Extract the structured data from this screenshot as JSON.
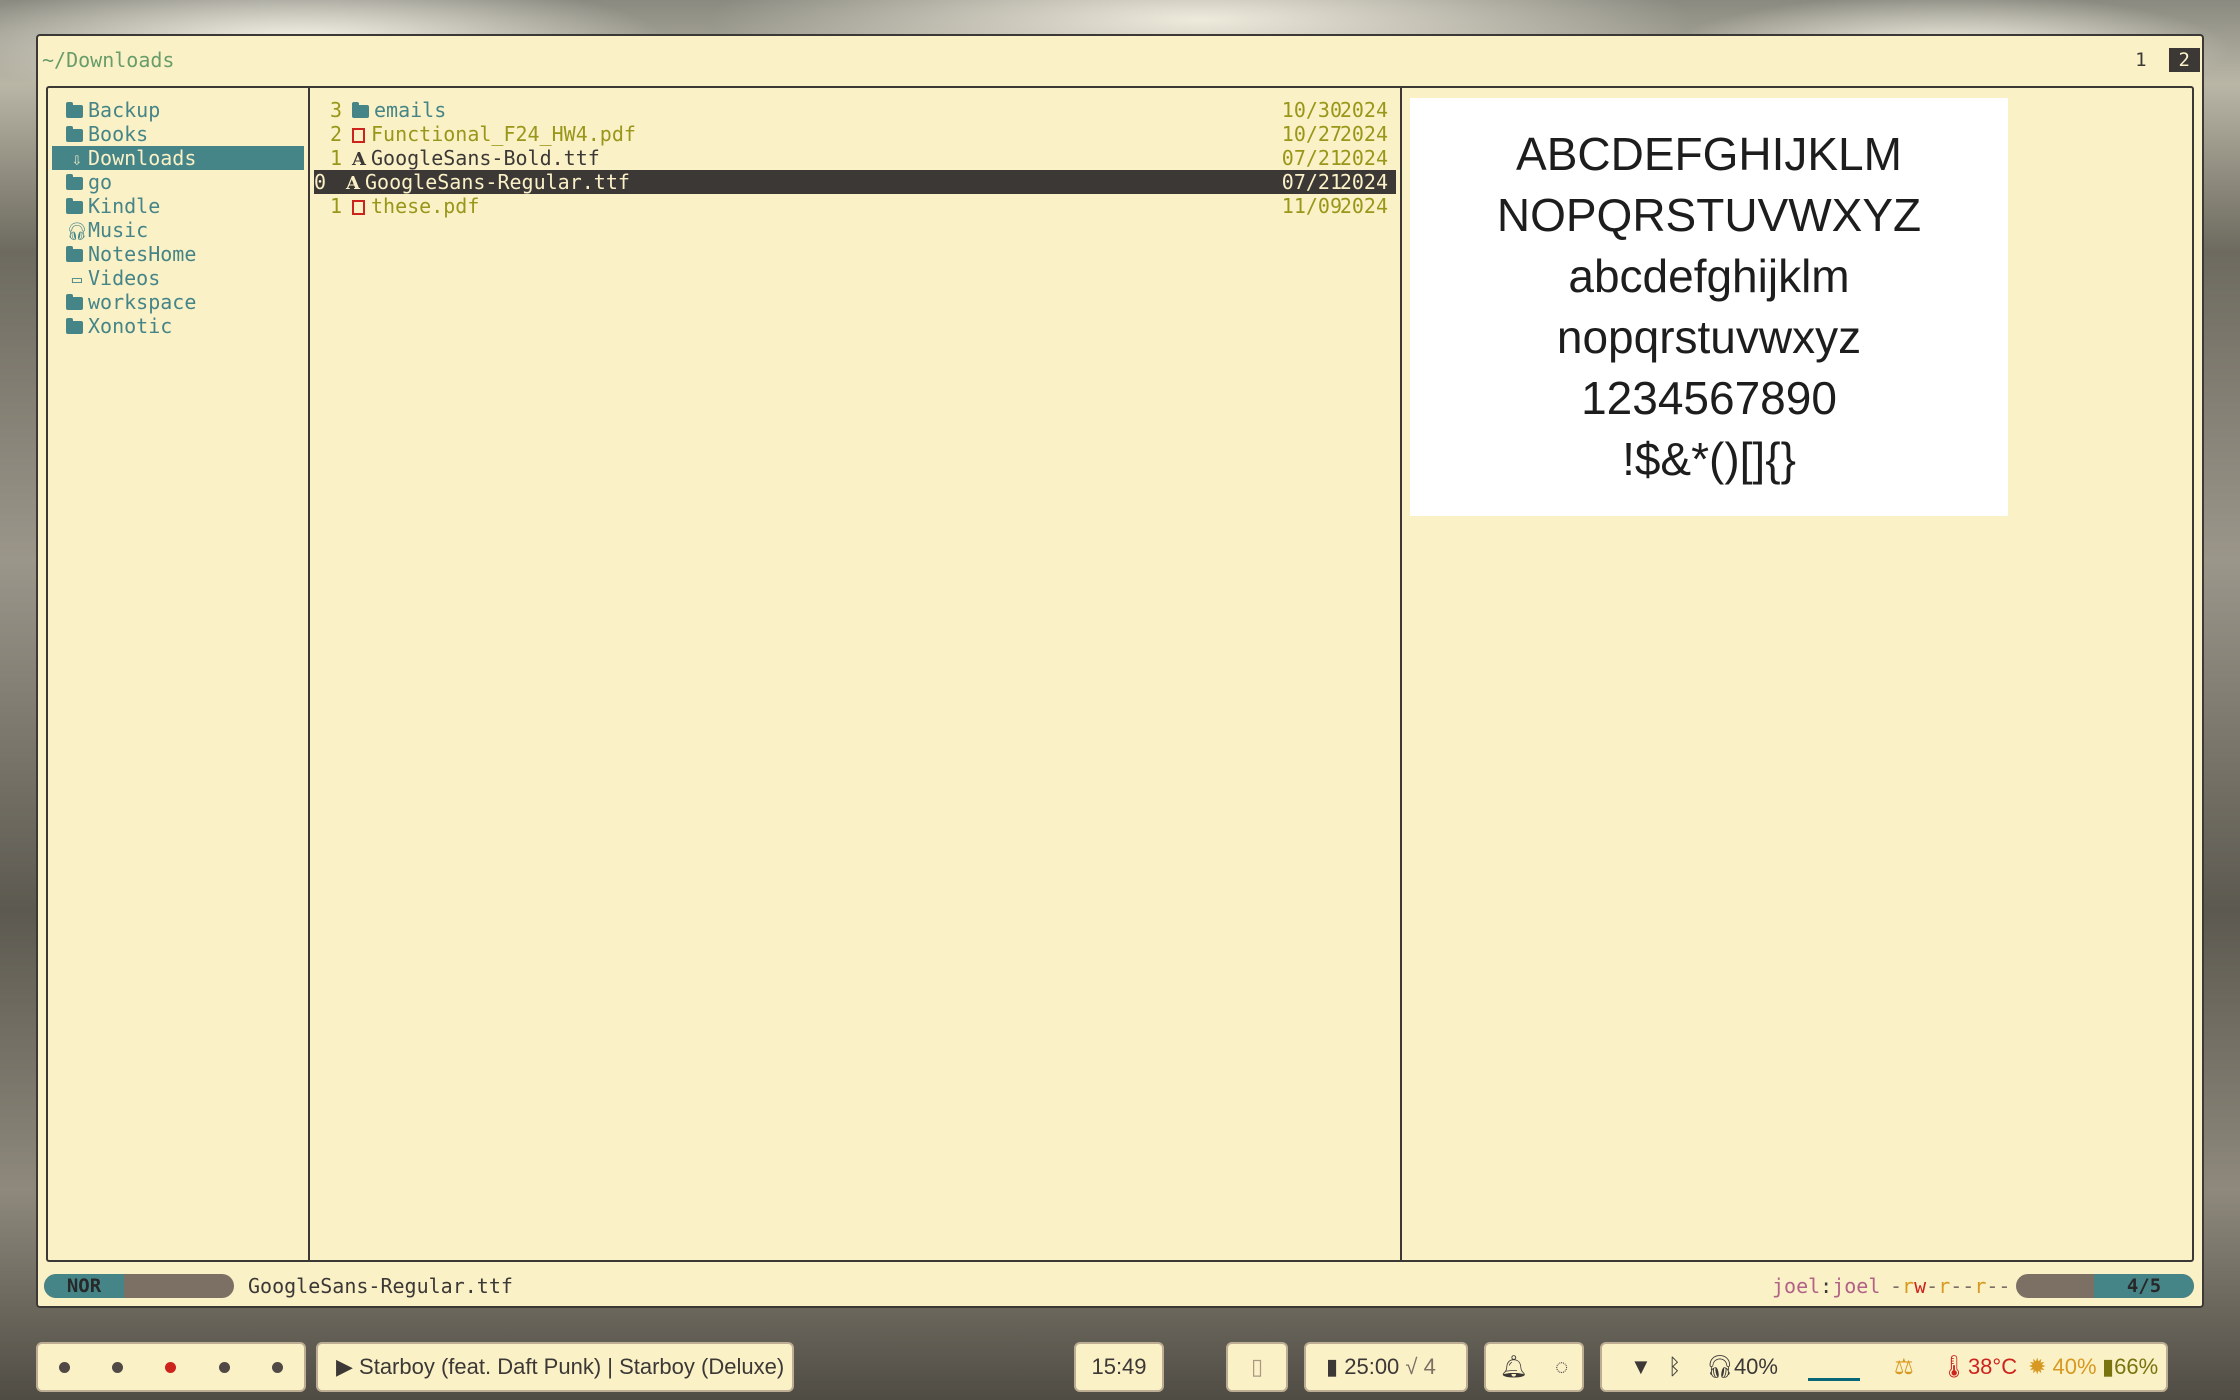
{
  "window": {
    "title": "~/Downloads",
    "tabs": [
      "1",
      "2"
    ],
    "active_tab": "2"
  },
  "sidebar": {
    "items": [
      {
        "label": "Backup",
        "icon": "folder-icon"
      },
      {
        "label": "Books",
        "icon": "folder-icon"
      },
      {
        "label": "Downloads",
        "icon": "download-icon",
        "selected": true
      },
      {
        "label": "go",
        "icon": "folder-icon"
      },
      {
        "label": "Kindle",
        "icon": "folder-icon"
      },
      {
        "label": "Music",
        "icon": "headphones-icon"
      },
      {
        "label": "NotesHome",
        "icon": "folder-icon"
      },
      {
        "label": "Videos",
        "icon": "video-icon"
      },
      {
        "label": "workspace",
        "icon": "folder-icon"
      },
      {
        "label": "Xonotic",
        "icon": "folder-icon"
      }
    ]
  },
  "files": [
    {
      "rel": "3",
      "name": "emails",
      "type": "folder",
      "date": "10/30",
      "year": "2024"
    },
    {
      "rel": "2",
      "name": "Functional_F24_HW4.pdf",
      "type": "pdf",
      "date": "10/27",
      "year": "2024"
    },
    {
      "rel": "1",
      "name": "GoogleSans-Bold.ttf",
      "type": "font",
      "date": "07/21",
      "year": "2024"
    },
    {
      "rel": "0",
      "name": "GoogleSans-Regular.ttf",
      "type": "font",
      "date": "07/21",
      "year": "2024",
      "cursor": true
    },
    {
      "rel": "1",
      "name": "these.pdf",
      "type": "pdf",
      "date": "11/09",
      "year": "2024"
    }
  ],
  "preview": {
    "lines": [
      "ABCDEFGHIJKLM",
      "NOPQRSTUVWXYZ",
      "abcdefghijklm",
      "nopqrstuvwxyz",
      "1234567890",
      "!$&*()[]{}"
    ]
  },
  "status": {
    "mode": "NOR",
    "file": "GoogleSans-Regular.ttf",
    "user": "joel",
    "sep": ":",
    "group": "joel",
    "perm_chars": [
      "-",
      "r",
      "w",
      "-",
      "r",
      "-",
      "-",
      "r",
      "-",
      "-"
    ],
    "count": "4/5"
  },
  "taskbar": {
    "media": "▶ Starboy (feat. Daft Punk) | Starboy (Deluxe)",
    "clock": "15:49",
    "pomodoro_time": "25:00",
    "pomodoro_done": "√ 4",
    "volume": "40%",
    "temperature": "38°C",
    "brightness": "40%",
    "battery": "66%",
    "colors": {
      "red": "#cc241d",
      "yellow": "#d79921",
      "green": "#98971a",
      "blue": "#458588"
    }
  }
}
